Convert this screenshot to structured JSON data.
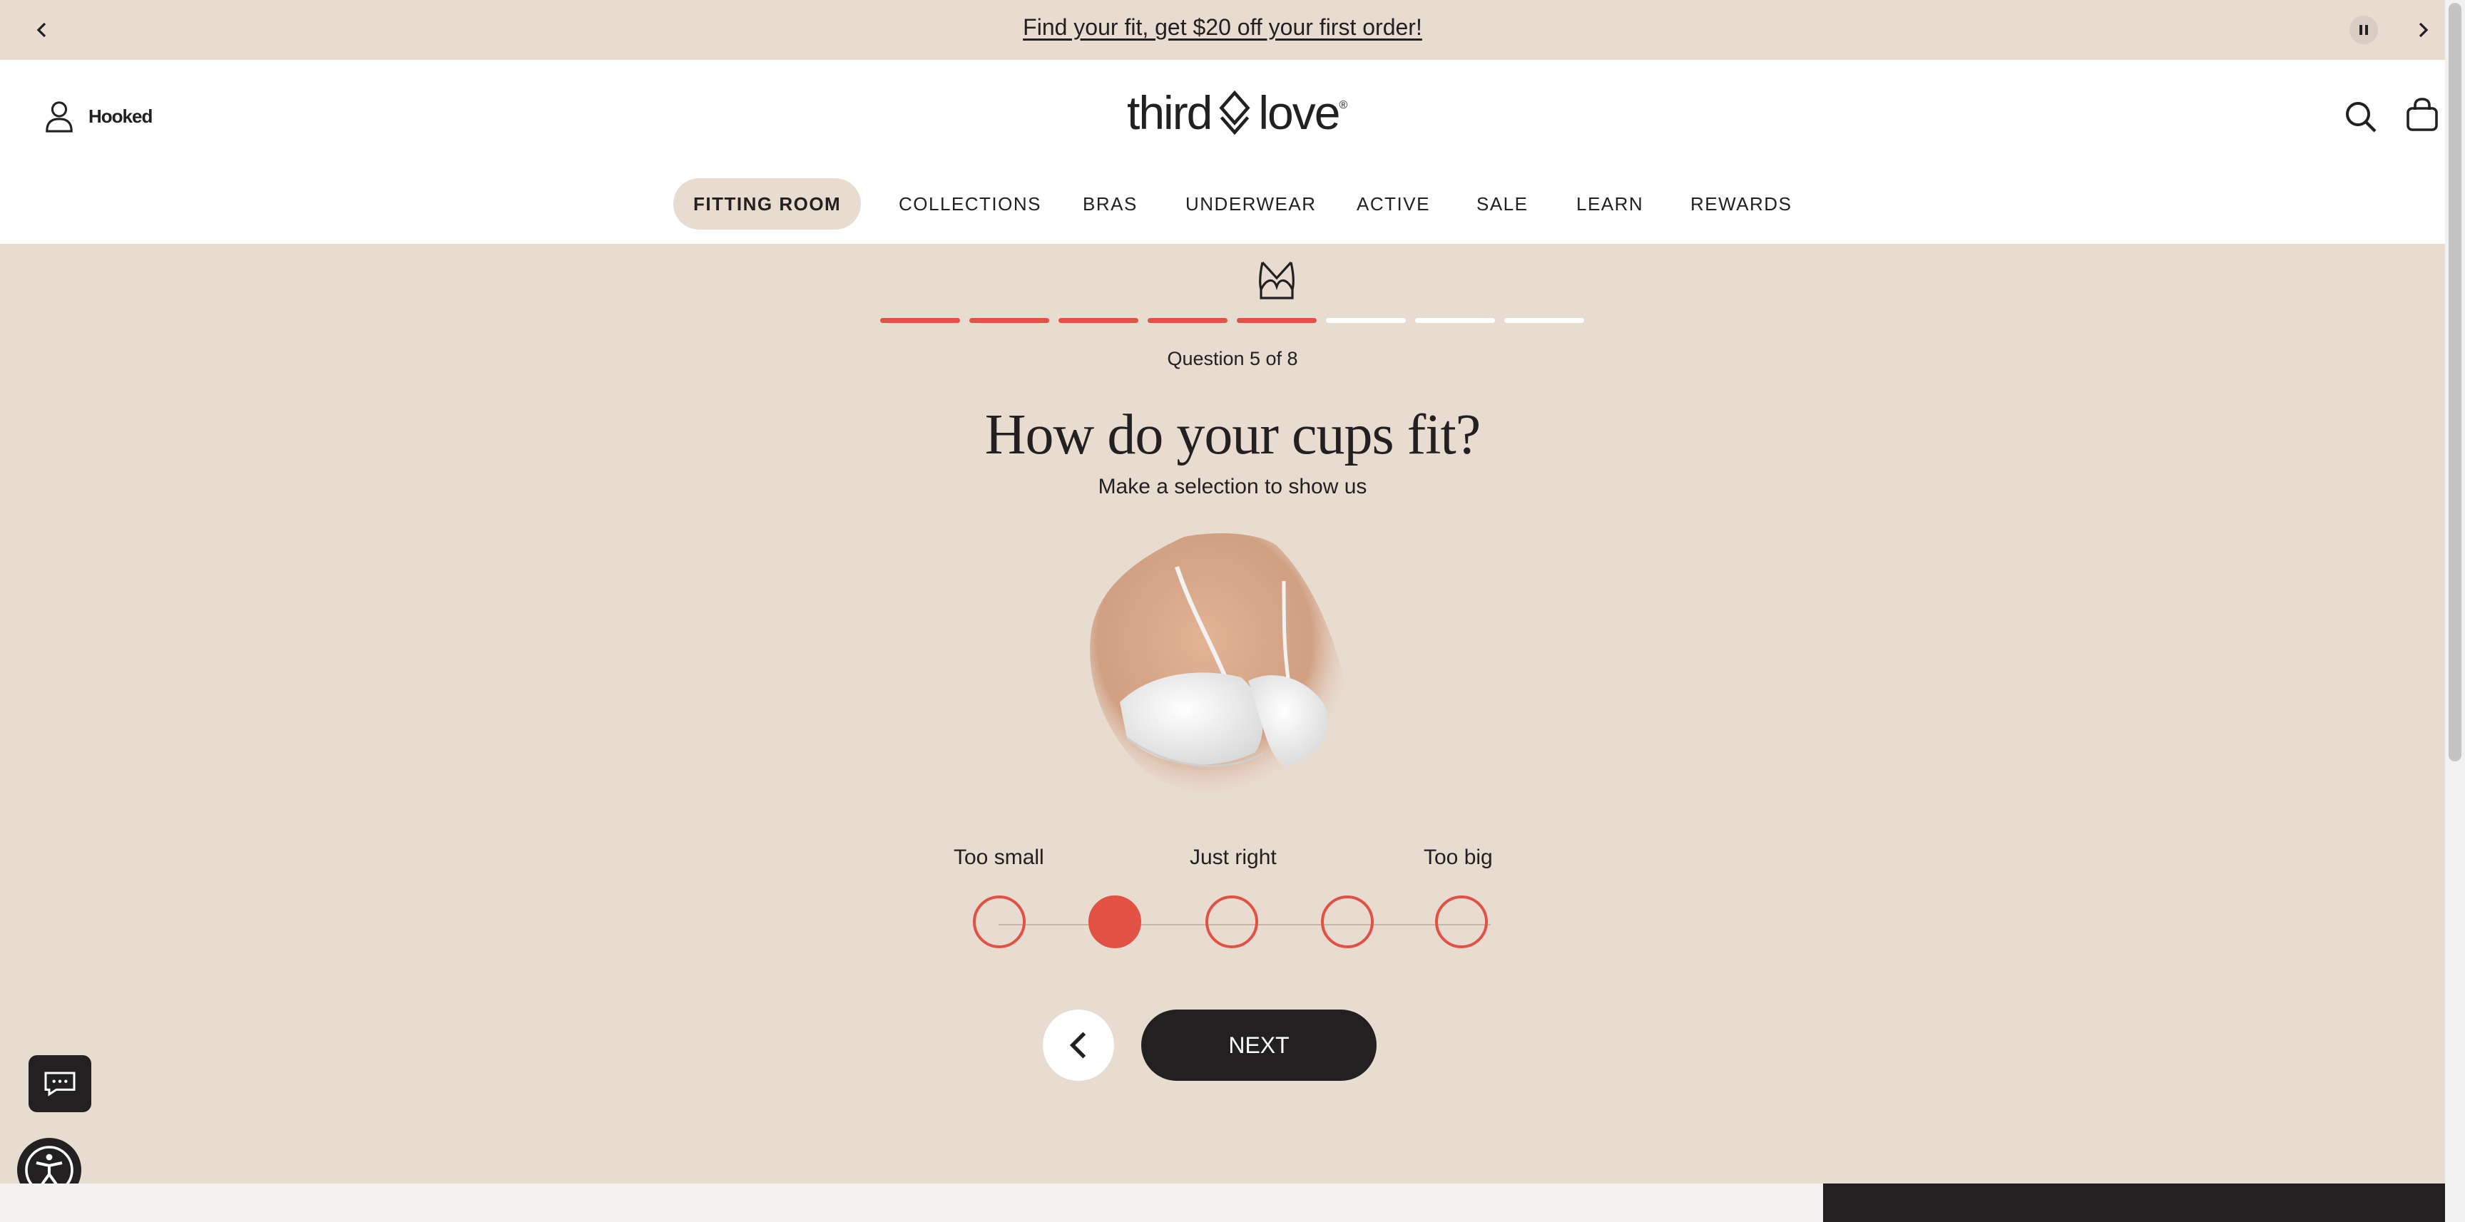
{
  "promo": {
    "text": "Find your fit, get $20 off your first order!",
    "prev_icon": "chevron-left-icon",
    "next_icon": "chevron-right-icon",
    "pause_icon": "pause-icon"
  },
  "header": {
    "account_label": "Hooked",
    "logo": {
      "word1": "third",
      "word2": "love",
      "mark": "®"
    },
    "icons": [
      "user-icon",
      "search-icon",
      "shopping-bag-icon"
    ]
  },
  "nav": {
    "items": [
      {
        "label": "FITTING ROOM",
        "active": true
      },
      {
        "label": "COLLECTIONS"
      },
      {
        "label": "BRAS"
      },
      {
        "label": "UNDERWEAR"
      },
      {
        "label": "ACTIVE"
      },
      {
        "label": "SALE"
      },
      {
        "label": "LEARN"
      },
      {
        "label": "REWARDS"
      }
    ]
  },
  "quiz": {
    "progress": {
      "current": 5,
      "total": 8
    },
    "question_label": "Question 5 of 8",
    "heading": "How do your cups fit?",
    "subheading": "Make a selection to show us",
    "scale": {
      "labels": [
        "Too small",
        "Just right",
        "Too big"
      ],
      "options": 5,
      "selected_index": 1
    },
    "next_label": "NEXT"
  },
  "colors": {
    "accent": "#e15245",
    "dark": "#232021",
    "background": "#e8dbd0"
  }
}
